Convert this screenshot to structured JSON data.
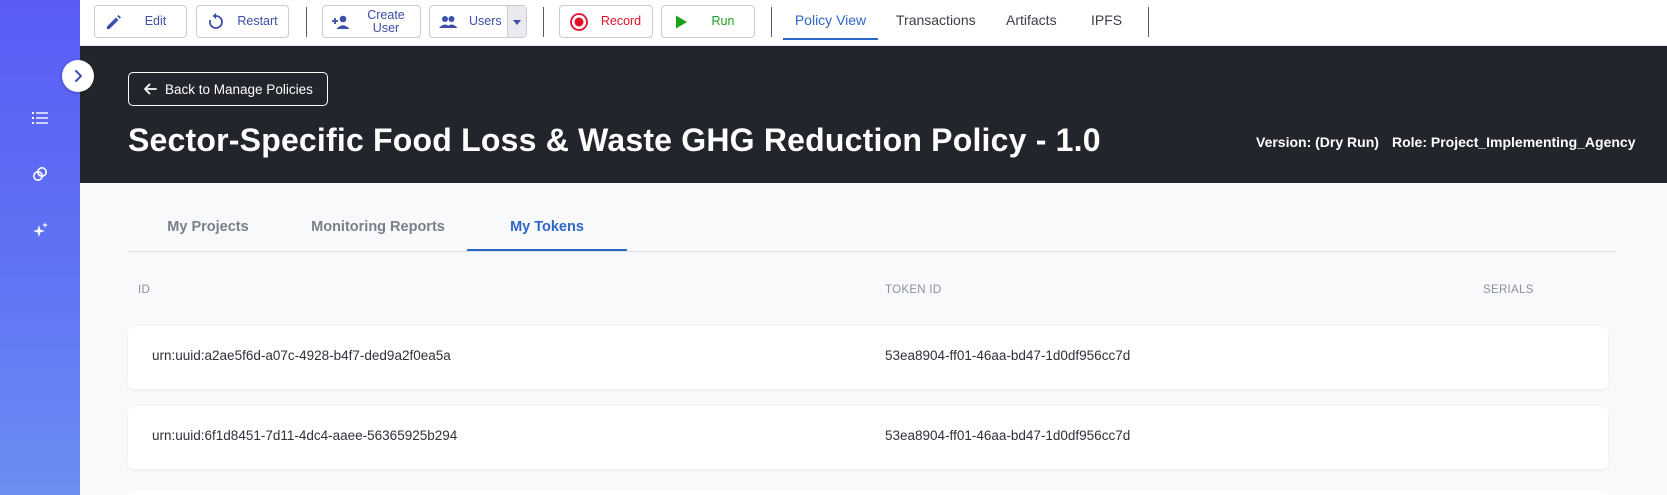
{
  "toolbar": {
    "edit_label": "Edit",
    "restart_label": "Restart",
    "create_user_label_line1": "Create",
    "create_user_label_line2": "User",
    "users_label": "Users",
    "record_label": "Record",
    "run_label": "Run",
    "view_tabs": [
      "Policy View",
      "Transactions",
      "Artifacts",
      "IPFS"
    ],
    "active_view_tab": "Policy View",
    "colors": {
      "accent": "#3d4fa8",
      "record": "#e0102a",
      "run": "#1aa31a"
    }
  },
  "sidebar": {
    "icons": [
      "list-icon",
      "link-icon",
      "sparkle-icon"
    ],
    "expand_icon": "chevron-right-icon"
  },
  "header": {
    "back_label": "Back to Manage Policies",
    "title": "Sector-Specific Food Loss & Waste GHG Reduction Policy - 1.0",
    "version": "Version: (Dry Run)",
    "role": "Role: Project_Implementing_Agency"
  },
  "content_tabs": {
    "items": [
      "My Projects",
      "Monitoring Reports",
      "My Tokens"
    ],
    "active": "My Tokens"
  },
  "table": {
    "headers": [
      "ID",
      "TOKEN ID",
      "SERIALS"
    ],
    "rows": [
      {
        "id": "urn:uuid:a2ae5f6d-a07c-4928-b4f7-ded9a2f0ea5a",
        "token_id": "53ea8904-ff01-46aa-bd47-1d0df956cc7d",
        "serials": ""
      },
      {
        "id": "urn:uuid:6f1d8451-7d11-4dc4-aaee-56365925b294",
        "token_id": "53ea8904-ff01-46aa-bd47-1d0df956cc7d",
        "serials": ""
      }
    ]
  }
}
